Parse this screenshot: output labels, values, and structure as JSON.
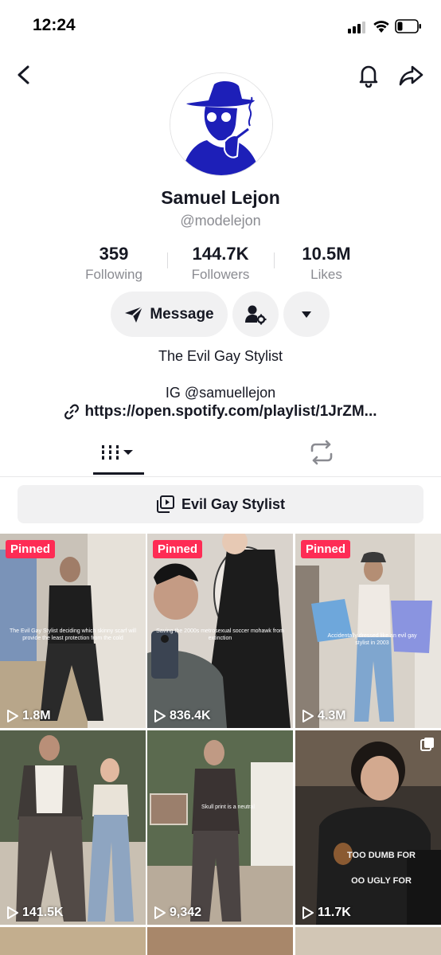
{
  "status": {
    "time": "12:24"
  },
  "profile": {
    "name": "Samuel Lejon",
    "handle": "@modelejon",
    "stats": [
      {
        "value": "359",
        "label": "Following"
      },
      {
        "value": "144.7K",
        "label": "Followers"
      },
      {
        "value": "10.5M",
        "label": "Likes"
      }
    ],
    "message_label": "Message",
    "bio": "The Evil Gay Stylist",
    "ig": "IG @samuellejon",
    "link": "https://open.spotify.com/playlist/1JrZM..."
  },
  "playlist_label": "Evil Gay Stylist",
  "videos": [
    {
      "views": "1.8M",
      "pinned": "Pinned",
      "caption": "The Evil Gay Stylist deciding which skinny scarf will provide the least protection from the cold",
      "bg": "#6e6a66"
    },
    {
      "views": "836.4K",
      "pinned": "Pinned",
      "caption": "Saving the 2000s metrosexual soccer mohawk from extinction",
      "bg": "#5d5a57"
    },
    {
      "views": "4.3M",
      "pinned": "Pinned",
      "caption": "Accidentally dressed like an evil gay stylist in 2003",
      "bg": "#8a8582"
    },
    {
      "views": "141.5K",
      "pinned": "",
      "caption": "",
      "bg": "#55604a"
    },
    {
      "views": "9,342",
      "pinned": "",
      "caption": "Skull print is a neutral",
      "bg": "#5b6a4f"
    },
    {
      "views": "11.7K",
      "pinned": "",
      "caption": "",
      "bg": "#3a342f"
    }
  ],
  "colors": {
    "accent": "#fe2c55",
    "avatar_blue": "#1d1fb8",
    "text": "#161823",
    "muted": "#8a8b91"
  }
}
